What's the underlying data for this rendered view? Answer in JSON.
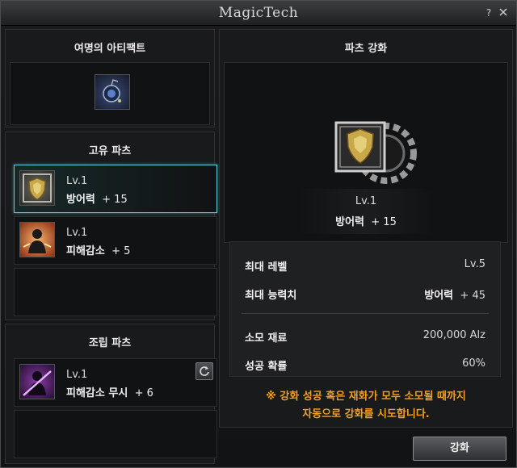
{
  "window": {
    "title": "MagicTech",
    "help_label": "?",
    "close_label": "x"
  },
  "left": {
    "artifact_title": "여명의 아티팩트",
    "unique_title": "고유 파츠",
    "unique_parts": [
      {
        "level": "Lv.1",
        "stat_name": "방어력",
        "stat_value": "+ 15",
        "selected": true,
        "icon": "shield-icon"
      },
      {
        "level": "Lv.1",
        "stat_name": "피해감소",
        "stat_value": "+ 5",
        "selected": false,
        "icon": "damage-reduction-icon"
      }
    ],
    "assembly_title": "조립 파츠",
    "assembly_parts": [
      {
        "level": "Lv.1",
        "stat_name": "피해감소 무시",
        "stat_value": "+ 6",
        "icon": "ignore-damage-reduction-icon"
      }
    ]
  },
  "right": {
    "title": "파츠 강화",
    "preview": {
      "level": "Lv.1",
      "stat_name": "방어력",
      "stat_value": "+ 15"
    },
    "info": {
      "max_level_label": "최대 레벨",
      "max_level_value": "Lv.5",
      "max_stat_label": "최대 능력치",
      "max_stat_name": "방어력",
      "max_stat_value": "+ 45",
      "material_label": "소모 재료",
      "material_value": "200,000 Alz",
      "rate_label": "성공 확률",
      "rate_value": "60%"
    },
    "notice_line1": "※ 강화 성공 혹은 재화가 모두 소모될 때까지",
    "notice_line2": "자동으로 강화를 시도합니다.",
    "enhance_button": "강화"
  },
  "colors": {
    "accent": "#5cd1d0",
    "notice": "#f0a020"
  }
}
